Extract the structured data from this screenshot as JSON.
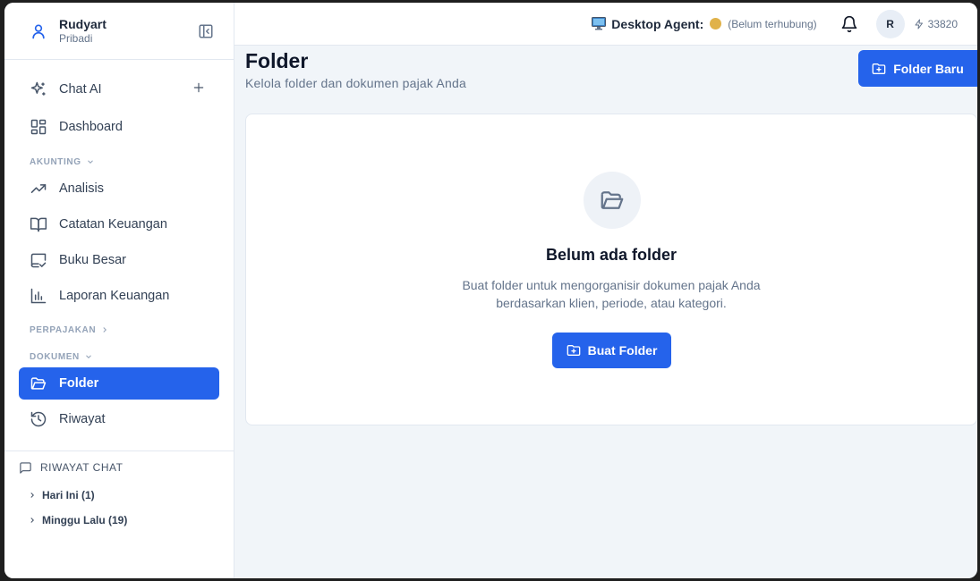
{
  "user": {
    "name": "Rudyart",
    "subtitle": "Pribadi"
  },
  "nav": {
    "chat_ai": "Chat AI",
    "dashboard": "Dashboard",
    "section_akunting": "AKUNTING",
    "analisis": "Analisis",
    "catatan": "Catatan Keuangan",
    "buku_besar": "Buku Besar",
    "laporan": "Laporan Keuangan",
    "section_perpajakan": "PERPAJAKAN",
    "section_dokumen": "DOKUMEN",
    "folder": "Folder",
    "riwayat": "Riwayat"
  },
  "chat_history": {
    "title": "RIWAYAT CHAT",
    "groups": [
      "Hari Ini (1)",
      "Minggu Lalu (19)"
    ]
  },
  "topbar": {
    "agent_label": "Desktop Agent:",
    "agent_status": "(Belum terhubung)",
    "avatar_initial": "R",
    "credits": "33820"
  },
  "page": {
    "title": "Folder",
    "subtitle": "Kelola folder dan dokumen pajak Anda",
    "new_folder_button": "Folder Baru"
  },
  "empty_state": {
    "title": "Belum ada folder",
    "desc_line1": "Buat folder untuk mengorganisir dokumen pajak Anda",
    "desc_line2": "berdasarkan klien, periode, atau kategori.",
    "button": "Buat Folder"
  },
  "colors": {
    "accent": "#2563eb",
    "status_dot": "#e0b24a"
  }
}
